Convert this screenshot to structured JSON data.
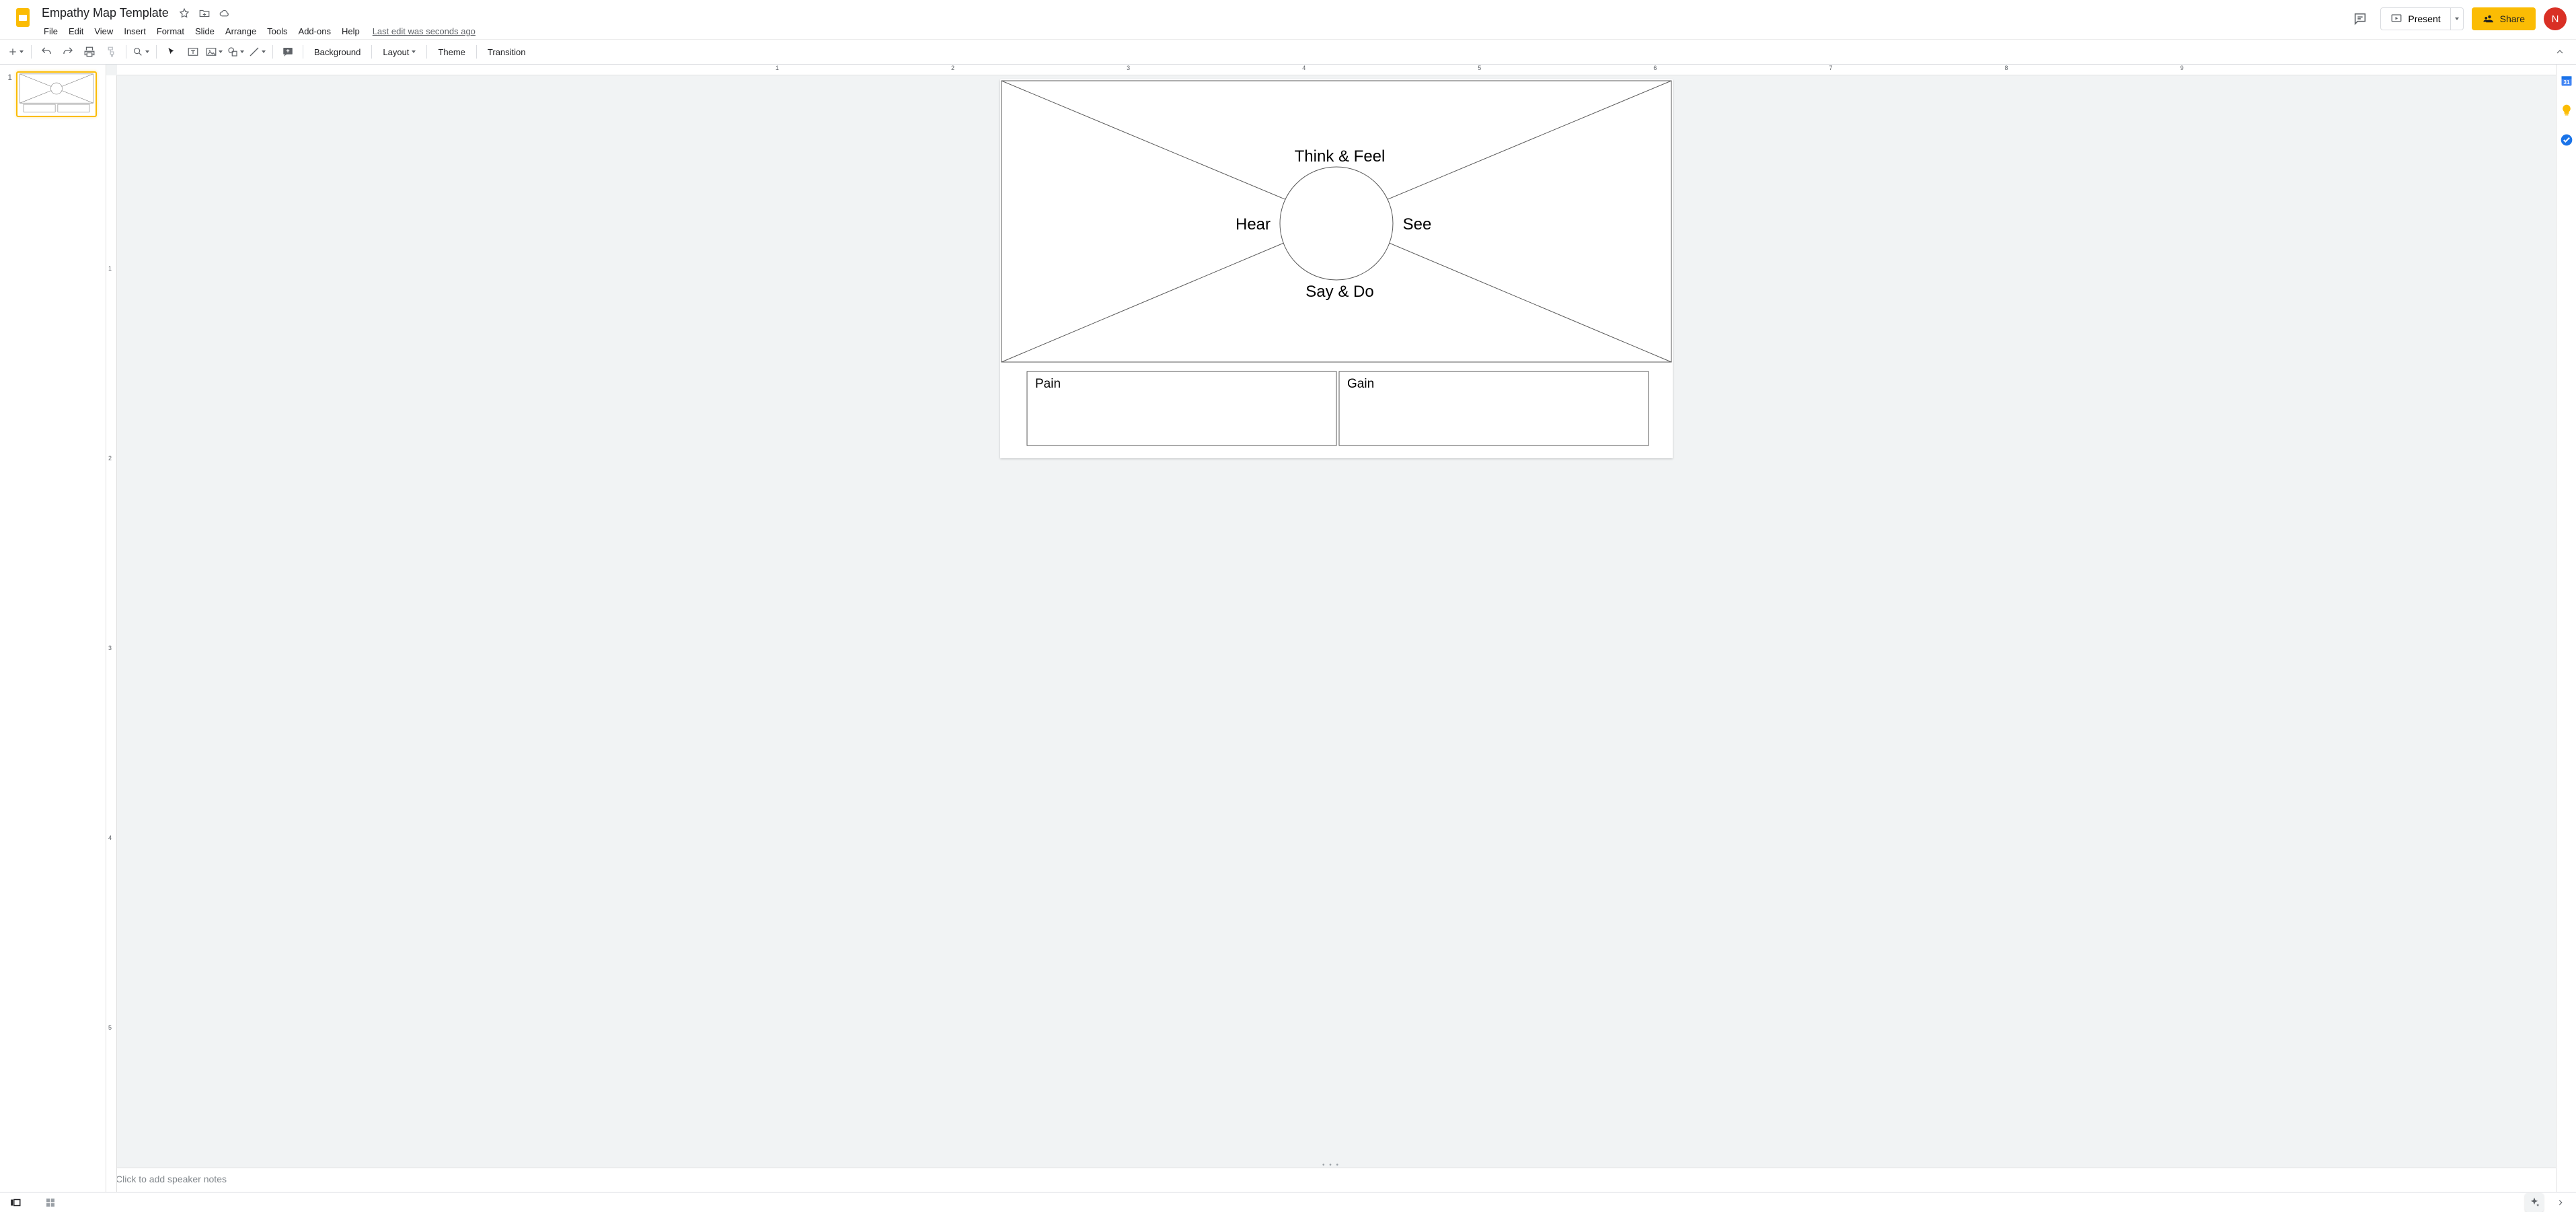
{
  "doc": {
    "title": "Empathy Map Template",
    "last_edit": "Last edit was seconds ago"
  },
  "menubar": [
    "File",
    "Edit",
    "View",
    "Insert",
    "Format",
    "Slide",
    "Arrange",
    "Tools",
    "Add-ons",
    "Help"
  ],
  "titlebar_right": {
    "present": "Present",
    "share": "Share",
    "avatar_initial": "N"
  },
  "toolbar_text": {
    "background": "Background",
    "layout": "Layout",
    "theme": "Theme",
    "transition": "Transition"
  },
  "filmstrip": {
    "slide_number": "1"
  },
  "slide": {
    "think_feel": "Think & Feel",
    "hear": "Hear",
    "see": "See",
    "say_do": "Say & Do",
    "pain": "Pain",
    "gain": "Gain"
  },
  "notes": {
    "placeholder": "Click to add speaker notes"
  },
  "ruler": {
    "h_ticks": [
      "1",
      "2",
      "3",
      "4",
      "5",
      "6",
      "7",
      "8",
      "9"
    ],
    "v_ticks": [
      "1",
      "2",
      "3",
      "4",
      "5"
    ]
  }
}
